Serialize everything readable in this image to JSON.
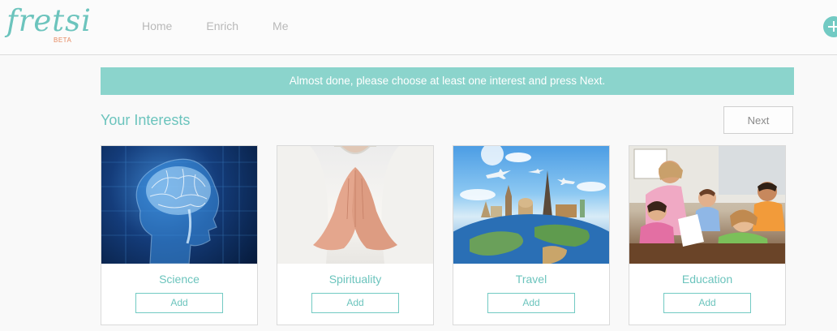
{
  "brand": {
    "logo": "fretsi",
    "badge": "BETA"
  },
  "nav": {
    "items": [
      "Home",
      "Enrich",
      "Me"
    ]
  },
  "header": {
    "add_icon": "plus-circle-icon"
  },
  "banner": {
    "text": "Almost done, please choose at least one interest and press Next."
  },
  "section": {
    "title": "Your Interests",
    "next_label": "Next"
  },
  "interests": [
    {
      "label": "Science",
      "add_label": "Add"
    },
    {
      "label": "Spirituality",
      "add_label": "Add"
    },
    {
      "label": "Travel",
      "add_label": "Add"
    },
    {
      "label": "Education",
      "add_label": "Add"
    }
  ],
  "colors": {
    "accent": "#6cc4bd",
    "banner": "#8bd4cc",
    "beta": "#e5885f"
  }
}
